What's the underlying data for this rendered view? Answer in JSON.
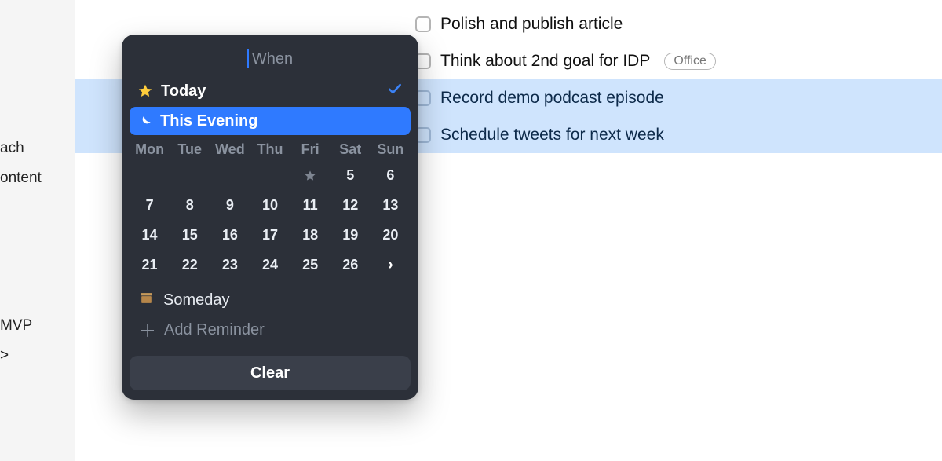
{
  "sidebar": {
    "items": [
      "ach",
      "ontent",
      "MVP",
      ">"
    ]
  },
  "tasks": {
    "rows": [
      {
        "title": "Polish and publish article"
      },
      {
        "title": "Think about 2nd goal for IDP",
        "tag": "Office"
      },
      {
        "title": "Record demo podcast episode"
      },
      {
        "title": "Schedule tweets for next week"
      }
    ]
  },
  "popover": {
    "search_placeholder": "When",
    "today_label": "Today",
    "evening_label": "This Evening",
    "calendar": {
      "weekdays": [
        "Mon",
        "Tue",
        "Wed",
        "Thu",
        "Fri",
        "Sat",
        "Sun"
      ],
      "rows": [
        [
          "",
          "",
          "",
          "",
          "star",
          "5",
          "6"
        ],
        [
          "7",
          "8",
          "9",
          "10",
          "11",
          "12",
          "13"
        ],
        [
          "14",
          "15",
          "16",
          "17",
          "18",
          "19",
          "20"
        ],
        [
          "21",
          "22",
          "23",
          "24",
          "25",
          "26",
          "›"
        ]
      ]
    },
    "someday_label": "Someday",
    "add_reminder_label": "Add Reminder",
    "clear_label": "Clear"
  }
}
